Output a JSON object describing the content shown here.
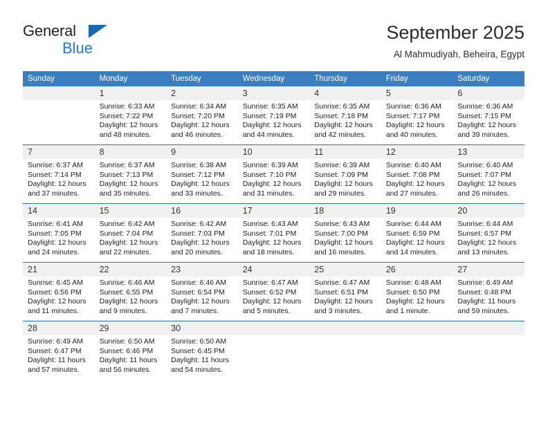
{
  "brand": {
    "name_top": "General",
    "name_bottom": "Blue",
    "flag_icon": "triangle-flag-icon",
    "accent_color": "#1a7fd4"
  },
  "header": {
    "title": "September 2025",
    "subtitle": "Al Mahmudiyah, Beheira, Egypt"
  },
  "theme": {
    "header_row_color": "#3b7ebf",
    "week_divider_color": "#2f6fae",
    "daynum_strip_color": "#f0f0f0"
  },
  "calendar": {
    "weekday_headers": [
      "Sunday",
      "Monday",
      "Tuesday",
      "Wednesday",
      "Thursday",
      "Friday",
      "Saturday"
    ],
    "weeks": [
      [
        {
          "day": "",
          "blank": true,
          "sunrise": "",
          "sunset": "",
          "daylight1": "",
          "daylight2": ""
        },
        {
          "day": "1",
          "sunrise": "Sunrise: 6:33 AM",
          "sunset": "Sunset: 7:22 PM",
          "daylight1": "Daylight: 12 hours",
          "daylight2": "and 48 minutes."
        },
        {
          "day": "2",
          "sunrise": "Sunrise: 6:34 AM",
          "sunset": "Sunset: 7:20 PM",
          "daylight1": "Daylight: 12 hours",
          "daylight2": "and 46 minutes."
        },
        {
          "day": "3",
          "sunrise": "Sunrise: 6:35 AM",
          "sunset": "Sunset: 7:19 PM",
          "daylight1": "Daylight: 12 hours",
          "daylight2": "and 44 minutes."
        },
        {
          "day": "4",
          "sunrise": "Sunrise: 6:35 AM",
          "sunset": "Sunset: 7:18 PM",
          "daylight1": "Daylight: 12 hours",
          "daylight2": "and 42 minutes."
        },
        {
          "day": "5",
          "sunrise": "Sunrise: 6:36 AM",
          "sunset": "Sunset: 7:17 PM",
          "daylight1": "Daylight: 12 hours",
          "daylight2": "and 40 minutes."
        },
        {
          "day": "6",
          "sunrise": "Sunrise: 6:36 AM",
          "sunset": "Sunset: 7:15 PM",
          "daylight1": "Daylight: 12 hours",
          "daylight2": "and 39 minutes."
        }
      ],
      [
        {
          "day": "7",
          "sunrise": "Sunrise: 6:37 AM",
          "sunset": "Sunset: 7:14 PM",
          "daylight1": "Daylight: 12 hours",
          "daylight2": "and 37 minutes."
        },
        {
          "day": "8",
          "sunrise": "Sunrise: 6:37 AM",
          "sunset": "Sunset: 7:13 PM",
          "daylight1": "Daylight: 12 hours",
          "daylight2": "and 35 minutes."
        },
        {
          "day": "9",
          "sunrise": "Sunrise: 6:38 AM",
          "sunset": "Sunset: 7:12 PM",
          "daylight1": "Daylight: 12 hours",
          "daylight2": "and 33 minutes."
        },
        {
          "day": "10",
          "sunrise": "Sunrise: 6:39 AM",
          "sunset": "Sunset: 7:10 PM",
          "daylight1": "Daylight: 12 hours",
          "daylight2": "and 31 minutes."
        },
        {
          "day": "11",
          "sunrise": "Sunrise: 6:39 AM",
          "sunset": "Sunset: 7:09 PM",
          "daylight1": "Daylight: 12 hours",
          "daylight2": "and 29 minutes."
        },
        {
          "day": "12",
          "sunrise": "Sunrise: 6:40 AM",
          "sunset": "Sunset: 7:08 PM",
          "daylight1": "Daylight: 12 hours",
          "daylight2": "and 27 minutes."
        },
        {
          "day": "13",
          "sunrise": "Sunrise: 6:40 AM",
          "sunset": "Sunset: 7:07 PM",
          "daylight1": "Daylight: 12 hours",
          "daylight2": "and 26 minutes."
        }
      ],
      [
        {
          "day": "14",
          "sunrise": "Sunrise: 6:41 AM",
          "sunset": "Sunset: 7:05 PM",
          "daylight1": "Daylight: 12 hours",
          "daylight2": "and 24 minutes."
        },
        {
          "day": "15",
          "sunrise": "Sunrise: 6:42 AM",
          "sunset": "Sunset: 7:04 PM",
          "daylight1": "Daylight: 12 hours",
          "daylight2": "and 22 minutes."
        },
        {
          "day": "16",
          "sunrise": "Sunrise: 6:42 AM",
          "sunset": "Sunset: 7:03 PM",
          "daylight1": "Daylight: 12 hours",
          "daylight2": "and 20 minutes."
        },
        {
          "day": "17",
          "sunrise": "Sunrise: 6:43 AM",
          "sunset": "Sunset: 7:01 PM",
          "daylight1": "Daylight: 12 hours",
          "daylight2": "and 18 minutes."
        },
        {
          "day": "18",
          "sunrise": "Sunrise: 6:43 AM",
          "sunset": "Sunset: 7:00 PM",
          "daylight1": "Daylight: 12 hours",
          "daylight2": "and 16 minutes."
        },
        {
          "day": "19",
          "sunrise": "Sunrise: 6:44 AM",
          "sunset": "Sunset: 6:59 PM",
          "daylight1": "Daylight: 12 hours",
          "daylight2": "and 14 minutes."
        },
        {
          "day": "20",
          "sunrise": "Sunrise: 6:44 AM",
          "sunset": "Sunset: 6:57 PM",
          "daylight1": "Daylight: 12 hours",
          "daylight2": "and 13 minutes."
        }
      ],
      [
        {
          "day": "21",
          "sunrise": "Sunrise: 6:45 AM",
          "sunset": "Sunset: 6:56 PM",
          "daylight1": "Daylight: 12 hours",
          "daylight2": "and 11 minutes."
        },
        {
          "day": "22",
          "sunrise": "Sunrise: 6:46 AM",
          "sunset": "Sunset: 6:55 PM",
          "daylight1": "Daylight: 12 hours",
          "daylight2": "and 9 minutes."
        },
        {
          "day": "23",
          "sunrise": "Sunrise: 6:46 AM",
          "sunset": "Sunset: 6:54 PM",
          "daylight1": "Daylight: 12 hours",
          "daylight2": "and 7 minutes."
        },
        {
          "day": "24",
          "sunrise": "Sunrise: 6:47 AM",
          "sunset": "Sunset: 6:52 PM",
          "daylight1": "Daylight: 12 hours",
          "daylight2": "and 5 minutes."
        },
        {
          "day": "25",
          "sunrise": "Sunrise: 6:47 AM",
          "sunset": "Sunset: 6:51 PM",
          "daylight1": "Daylight: 12 hours",
          "daylight2": "and 3 minutes."
        },
        {
          "day": "26",
          "sunrise": "Sunrise: 6:48 AM",
          "sunset": "Sunset: 6:50 PM",
          "daylight1": "Daylight: 12 hours",
          "daylight2": "and 1 minute."
        },
        {
          "day": "27",
          "sunrise": "Sunrise: 6:49 AM",
          "sunset": "Sunset: 6:48 PM",
          "daylight1": "Daylight: 11 hours",
          "daylight2": "and 59 minutes."
        }
      ],
      [
        {
          "day": "28",
          "sunrise": "Sunrise: 6:49 AM",
          "sunset": "Sunset: 6:47 PM",
          "daylight1": "Daylight: 11 hours",
          "daylight2": "and 57 minutes."
        },
        {
          "day": "29",
          "sunrise": "Sunrise: 6:50 AM",
          "sunset": "Sunset: 6:46 PM",
          "daylight1": "Daylight: 11 hours",
          "daylight2": "and 56 minutes."
        },
        {
          "day": "30",
          "sunrise": "Sunrise: 6:50 AM",
          "sunset": "Sunset: 6:45 PM",
          "daylight1": "Daylight: 11 hours",
          "daylight2": "and 54 minutes."
        },
        {
          "day": "",
          "blank": true,
          "sunrise": "",
          "sunset": "",
          "daylight1": "",
          "daylight2": ""
        },
        {
          "day": "",
          "blank": true,
          "sunrise": "",
          "sunset": "",
          "daylight1": "",
          "daylight2": ""
        },
        {
          "day": "",
          "blank": true,
          "sunrise": "",
          "sunset": "",
          "daylight1": "",
          "daylight2": ""
        },
        {
          "day": "",
          "blank": true,
          "sunrise": "",
          "sunset": "",
          "daylight1": "",
          "daylight2": ""
        }
      ]
    ]
  }
}
